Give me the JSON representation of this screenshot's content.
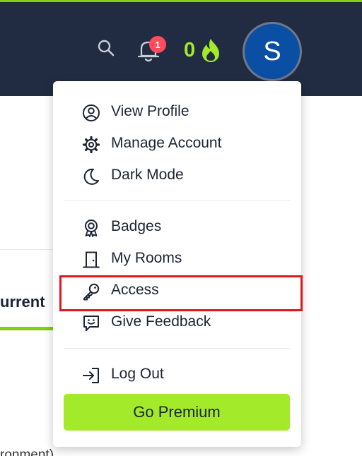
{
  "header": {
    "notification_count": "1",
    "streak_count": "0",
    "avatar_letter": "S"
  },
  "background": {
    "tab_label": "urrent",
    "text_snippet": "ronment) and experience an"
  },
  "menu": {
    "items": [
      {
        "label": "View Profile",
        "icon": "user-circle-icon"
      },
      {
        "label": "Manage Account",
        "icon": "gear-icon"
      },
      {
        "label": "Dark Mode",
        "icon": "moon-icon"
      },
      {
        "label": "Badges",
        "icon": "badge-icon"
      },
      {
        "label": "My Rooms",
        "icon": "door-icon"
      },
      {
        "label": "Access",
        "icon": "key-icon"
      },
      {
        "label": "Give Feedback",
        "icon": "feedback-icon"
      },
      {
        "label": "Log Out",
        "icon": "logout-icon"
      }
    ],
    "premium_label": "Go Premium"
  },
  "colors": {
    "header_bg": "#212c42",
    "accent_green": "#a3ea2a",
    "badge_red": "#ff4b5c",
    "avatar_blue": "#0a4fa3",
    "highlight_red": "#e4161d"
  }
}
